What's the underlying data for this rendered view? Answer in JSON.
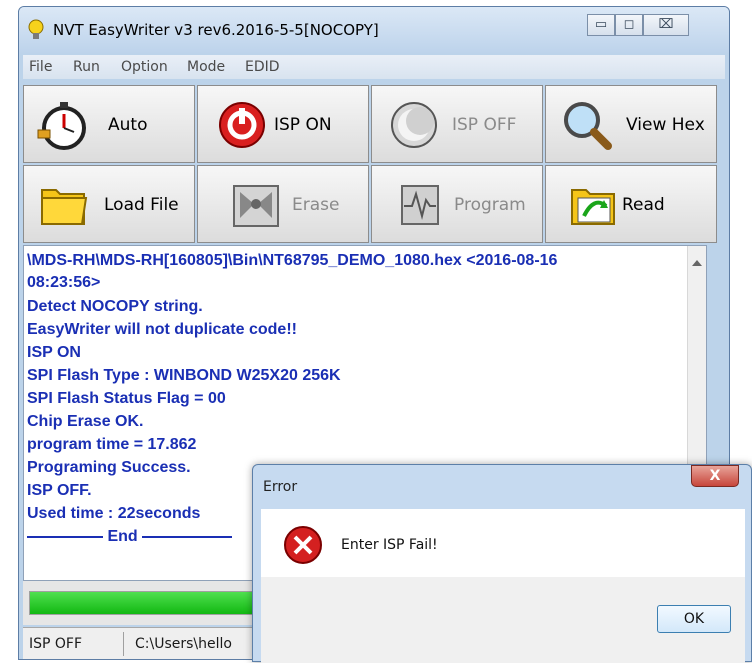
{
  "window": {
    "title": "NVT EasyWriter v3 rev6.2016-5-5[NOCOPY]",
    "controls": {
      "minimize": "▭",
      "maximize": "◻",
      "close": "⌧"
    }
  },
  "menu": [
    "File",
    "Run",
    "Option",
    "Mode",
    "EDID"
  ],
  "toolbar": {
    "auto": "Auto",
    "isp_on": "ISP ON",
    "isp_off": "ISP OFF",
    "view_hex": "View Hex",
    "load_file": "Load File",
    "erase": "Erase",
    "program": "Program",
    "read": "Read"
  },
  "log": [
    "\\MDS-RH\\MDS-RH[160805]\\Bin\\NT68795_DEMO_1080.hex <2016-08-16",
    "08:23:56>",
    "Detect NOCOPY string.",
    "EasyWriter will not duplicate code!!",
    "ISP ON",
    "SPI Flash Type : WINBOND W25X20 256K",
    "SPI Flash Status Flag = 00",
    "Chip Erase OK.",
    "program time = 17.862",
    "Programing Success.",
    "ISP OFF.",
    "Used time : 22seconds",
    "End"
  ],
  "progress": {
    "fraction": 1.0,
    "color": "#22c722"
  },
  "status": {
    "left": "ISP OFF",
    "path": "C:\\Users\\hello"
  },
  "dialog": {
    "title": "Error",
    "close_label": "X",
    "message": "Enter ISP Fail!",
    "ok": "OK"
  },
  "colors": {
    "log_text": "#1a2fb4",
    "accent": "#bcd3ea"
  }
}
